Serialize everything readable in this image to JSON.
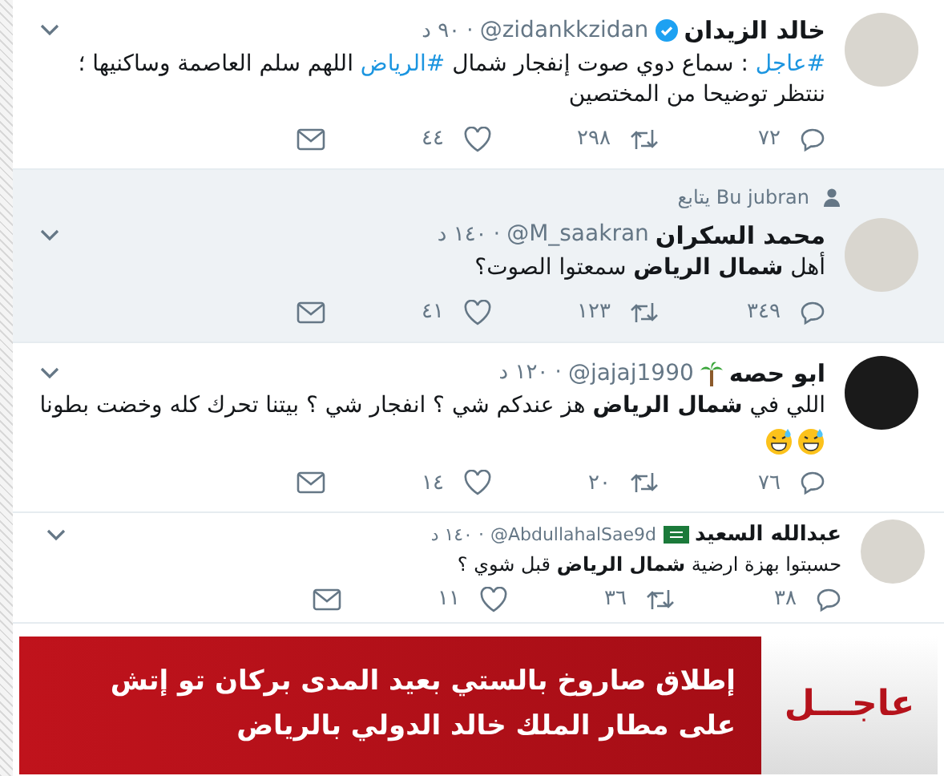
{
  "tweets": [
    {
      "kind": "verified",
      "name": "خالد الزيدان",
      "handle": "@zidankkzidan",
      "time": "· ٩٠ د",
      "highlighted": false,
      "small": false,
      "body": [
        {
          "kind": "hashtag",
          "text": "#عاجل"
        },
        {
          "kind": "plain",
          "text": " : سماع دوي صوت إنفجار شمال "
        },
        {
          "kind": "hashtag",
          "text": "#الرياض"
        },
        {
          "kind": "plain",
          "text": " اللهم سلم العاصمة وساكنيها ؛ ننتظر توضيحا من المختصين"
        }
      ],
      "emoji": false,
      "replies": "٧٢",
      "retweets": "٢٩٨",
      "likes": "٤٤"
    },
    {
      "kind": "plain",
      "context": "Bu jubran يتابع",
      "name": "محمد السكران",
      "handle": "@M_saakran",
      "time": "· ١٤٠ د",
      "highlighted": true,
      "small": false,
      "body": [
        {
          "kind": "plain",
          "text": "أهل "
        },
        {
          "kind": "bold",
          "text": "شمال الرياض"
        },
        {
          "kind": "plain",
          "text": " سمعتوا الصوت؟"
        }
      ],
      "emoji": false,
      "replies": "٣٤٩",
      "retweets": "١٢٣",
      "likes": "٤١"
    },
    {
      "kind": "palm",
      "name": "ابو حصه",
      "handle": "@jajaj1990",
      "time": "· ١٢٠ د",
      "highlighted": false,
      "small": false,
      "body": [
        {
          "kind": "plain",
          "text": "اللي في "
        },
        {
          "kind": "bold",
          "text": "شمال الرياض"
        },
        {
          "kind": "plain",
          "text": " هز عندكم شي ؟ انفجار شي ؟ بيتنا تحرك كله وخضت بطونا"
        }
      ],
      "emoji": true,
      "replies": "٧٦",
      "retweets": "٢٠",
      "likes": "١٤"
    },
    {
      "kind": "flag",
      "name": "عبدالله السعيد",
      "handle": "@AbdullahalSae9d",
      "time": "· ١٤٠ د",
      "highlighted": false,
      "small": true,
      "body": [
        {
          "kind": "plain",
          "text": "حسبتوا بهزة ارضية "
        },
        {
          "kind": "bold",
          "text": "شمال الرياض"
        },
        {
          "kind": "plain",
          "text": " قبل شوي ؟"
        }
      ],
      "emoji": false,
      "replies": "٣٨",
      "retweets": "٣٦",
      "likes": "١١"
    }
  ],
  "banner": {
    "label": "عاجـــل",
    "headline": "إطلاق صاروخ بالستي بعيد المدى بركان تو إتش على مطار الملك خالد الدولي بالرياض"
  }
}
